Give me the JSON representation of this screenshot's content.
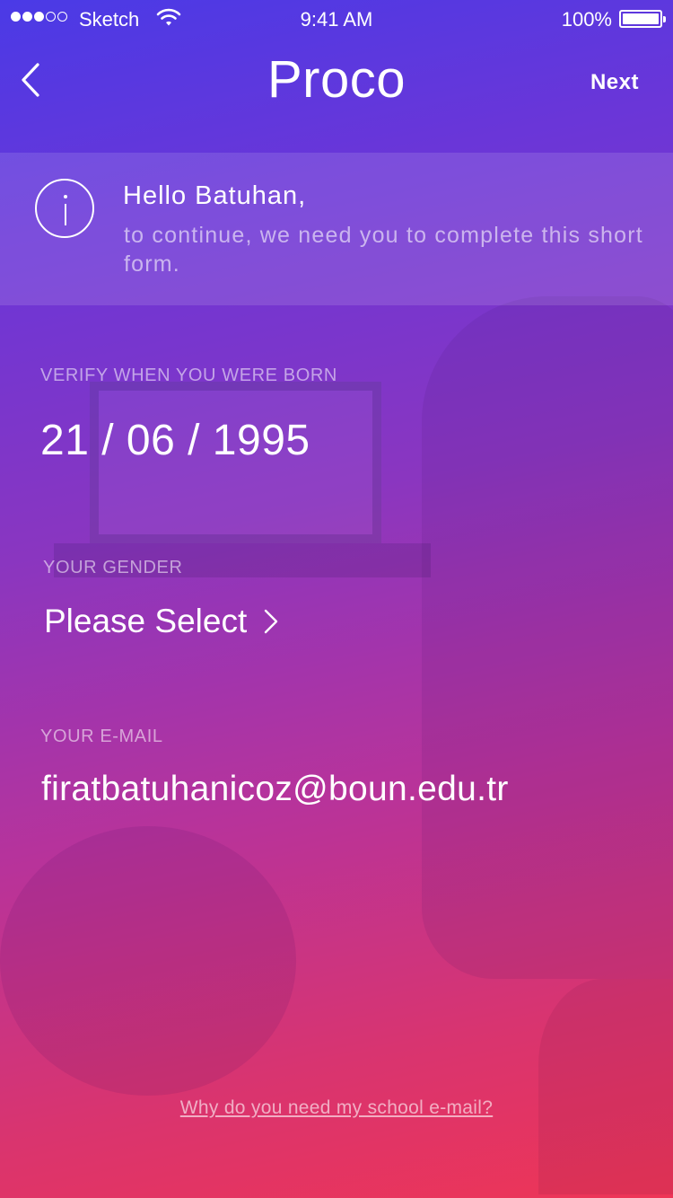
{
  "status_bar": {
    "carrier": "Sketch",
    "time": "9:41 AM",
    "battery": "100%",
    "signal_bars_filled": 3,
    "signal_bars_total": 5
  },
  "nav": {
    "title": "Proco",
    "next_label": "Next",
    "back_icon": "chevron-left-icon"
  },
  "banner": {
    "icon": "info-icon",
    "greeting": "Hello Batuhan,",
    "message": "to continue, we need you to complete this short form."
  },
  "form": {
    "born_label": "VERIFY WHEN YOU WERE BORN",
    "born_value": "21 / 06 / 1995",
    "gender_label": "YOUR GENDER",
    "gender_value": "Please Select",
    "email_label": "YOUR E-MAIL",
    "email_value": "firatbatuhanicoz@boun.edu.tr"
  },
  "help_link": "Why do you need my school e-mail?",
  "colors": {
    "gradient_top": "#4a3ae6",
    "gradient_mid": "#8a36c0",
    "gradient_bottom": "#ee3556",
    "text": "#ffffff"
  }
}
